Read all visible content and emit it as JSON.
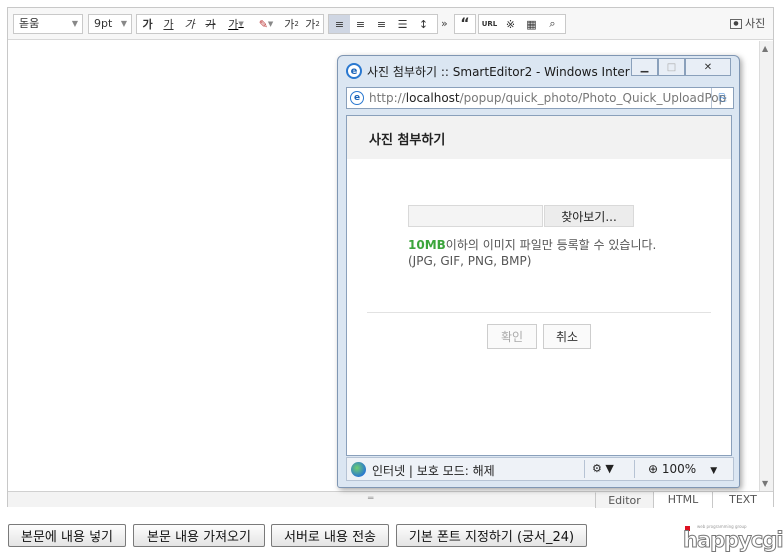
{
  "toolbar": {
    "font_name": "돋움",
    "font_size": "9pt",
    "bold": "가",
    "underline": "가",
    "italic": "가",
    "strike": "가",
    "font_color": "가",
    "superscript": "가",
    "subscript": "가",
    "more": "»",
    "quote": "“",
    "url": "URL",
    "photo_label": "사진"
  },
  "editor_status": {
    "modes": [
      "Editor",
      "HTML",
      "TEXT"
    ],
    "active_mode": "Editor"
  },
  "popup": {
    "window_title": "사진 첨부하기 :: SmartEditor2 - Windows Inter…",
    "url_prefix": "http://",
    "url_host": "localhost",
    "url_path": "/popup/quick_photo/Photo_Quick_UploadPop",
    "heading": "사진 첨부하기",
    "browse_label": "찾아보기...",
    "size_limit": "10MB",
    "note_line1": "이하의 이미지 파일만 등록할 수 있습니다.",
    "note_line2": "(JPG, GIF, PNG, BMP)",
    "confirm_label": "확인",
    "cancel_label": "취소",
    "status_text": "인터넷 | 보호 모드: 해제",
    "zoom": "100%"
  },
  "bottom_buttons": [
    "본문에 내용 넣기",
    "본문 내용 가져오기",
    "서버로 내용 전송",
    "기본 폰트 지정하기 (궁서_24)"
  ],
  "logo": {
    "tagline": "web programming group",
    "name": "happycgi"
  },
  "colors": {
    "accent_green": "#3ca53c",
    "ie_blue": "#2a78d0"
  }
}
